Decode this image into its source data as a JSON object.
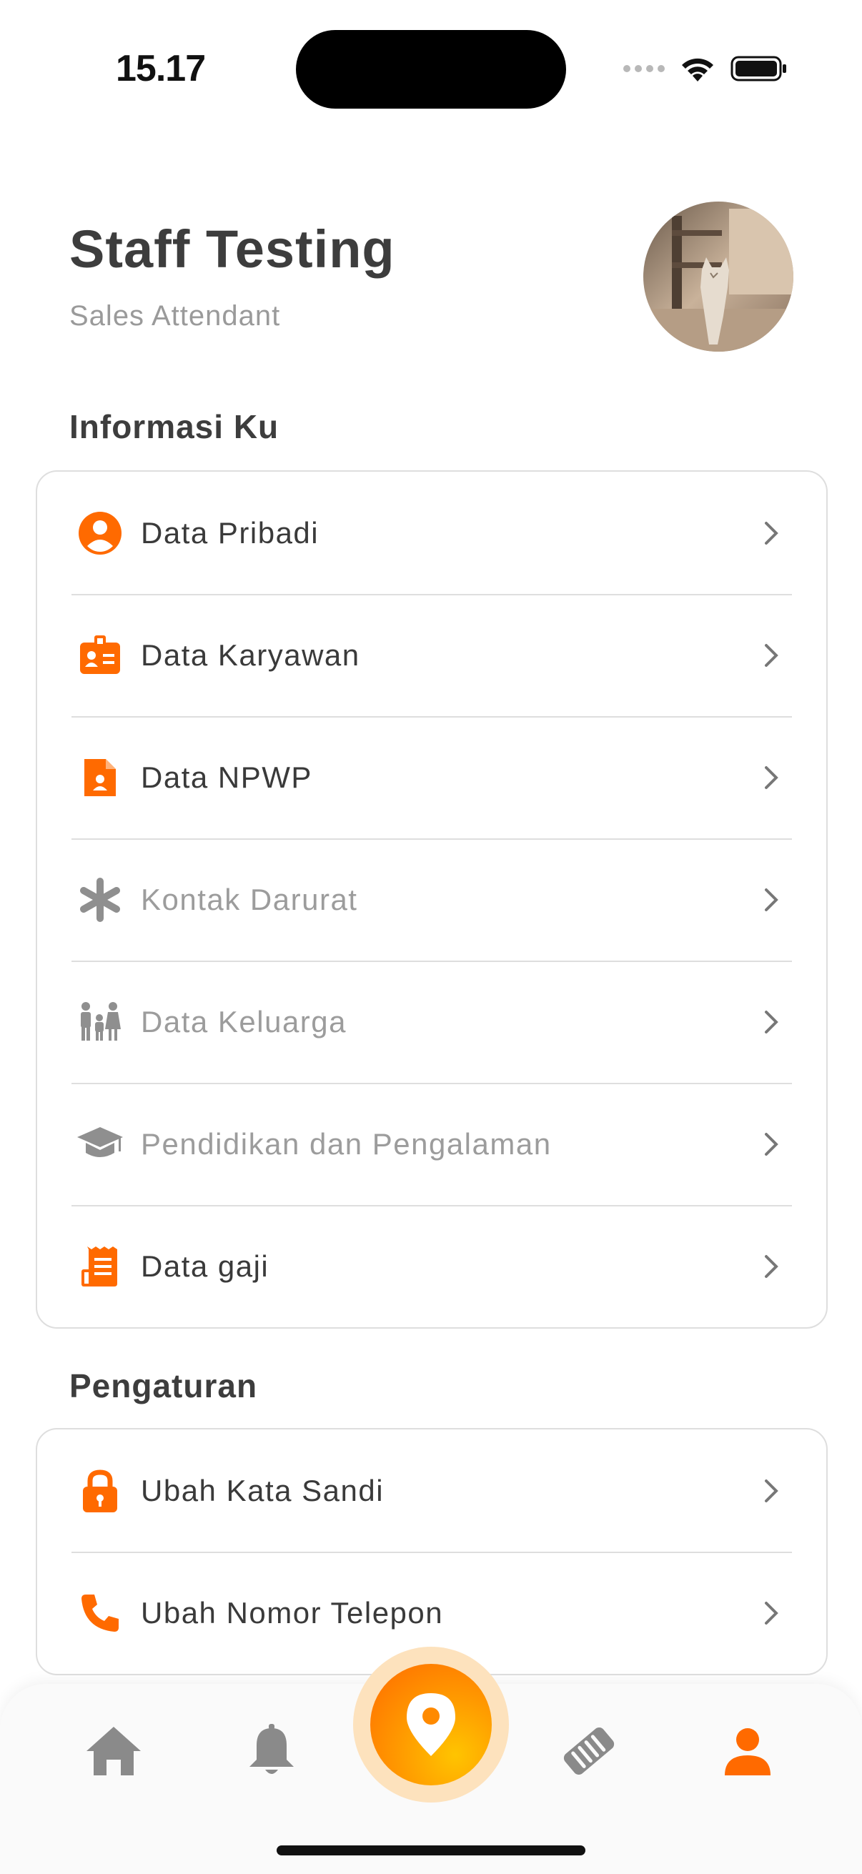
{
  "status_bar": {
    "time": "15.17"
  },
  "profile": {
    "name": "Staff Testing",
    "role": "Sales Attendant"
  },
  "sections": {
    "info_title": "Informasi Ku",
    "settings_title": "Pengaturan"
  },
  "info_items": [
    {
      "label": "Data Pribadi",
      "icon": "person-circle-icon",
      "enabled": true
    },
    {
      "label": "Data Karyawan",
      "icon": "id-badge-icon",
      "enabled": true
    },
    {
      "label": "Data NPWP",
      "icon": "document-person-icon",
      "enabled": true
    },
    {
      "label": "Kontak Darurat",
      "icon": "asterisk-icon",
      "enabled": false
    },
    {
      "label": "Data Keluarga",
      "icon": "family-icon",
      "enabled": false
    },
    {
      "label": "Pendidikan dan Pengalaman",
      "icon": "graduation-cap-icon",
      "enabled": false
    },
    {
      "label": "Data gaji",
      "icon": "receipt-icon",
      "enabled": true
    }
  ],
  "settings_items": [
    {
      "label": "Ubah Kata Sandi",
      "icon": "lock-icon"
    },
    {
      "label": "Ubah Nomor Telepon",
      "icon": "phone-icon"
    }
  ],
  "bottom_nav": {
    "items": [
      "home-icon",
      "bell-icon",
      "location-pin-icon",
      "handshake-icon",
      "profile-icon"
    ],
    "active": "profile-icon"
  },
  "colors": {
    "accent": "#ff6a00",
    "disabled": "#9c9c9c",
    "nav_inactive": "#8a8a8a"
  }
}
